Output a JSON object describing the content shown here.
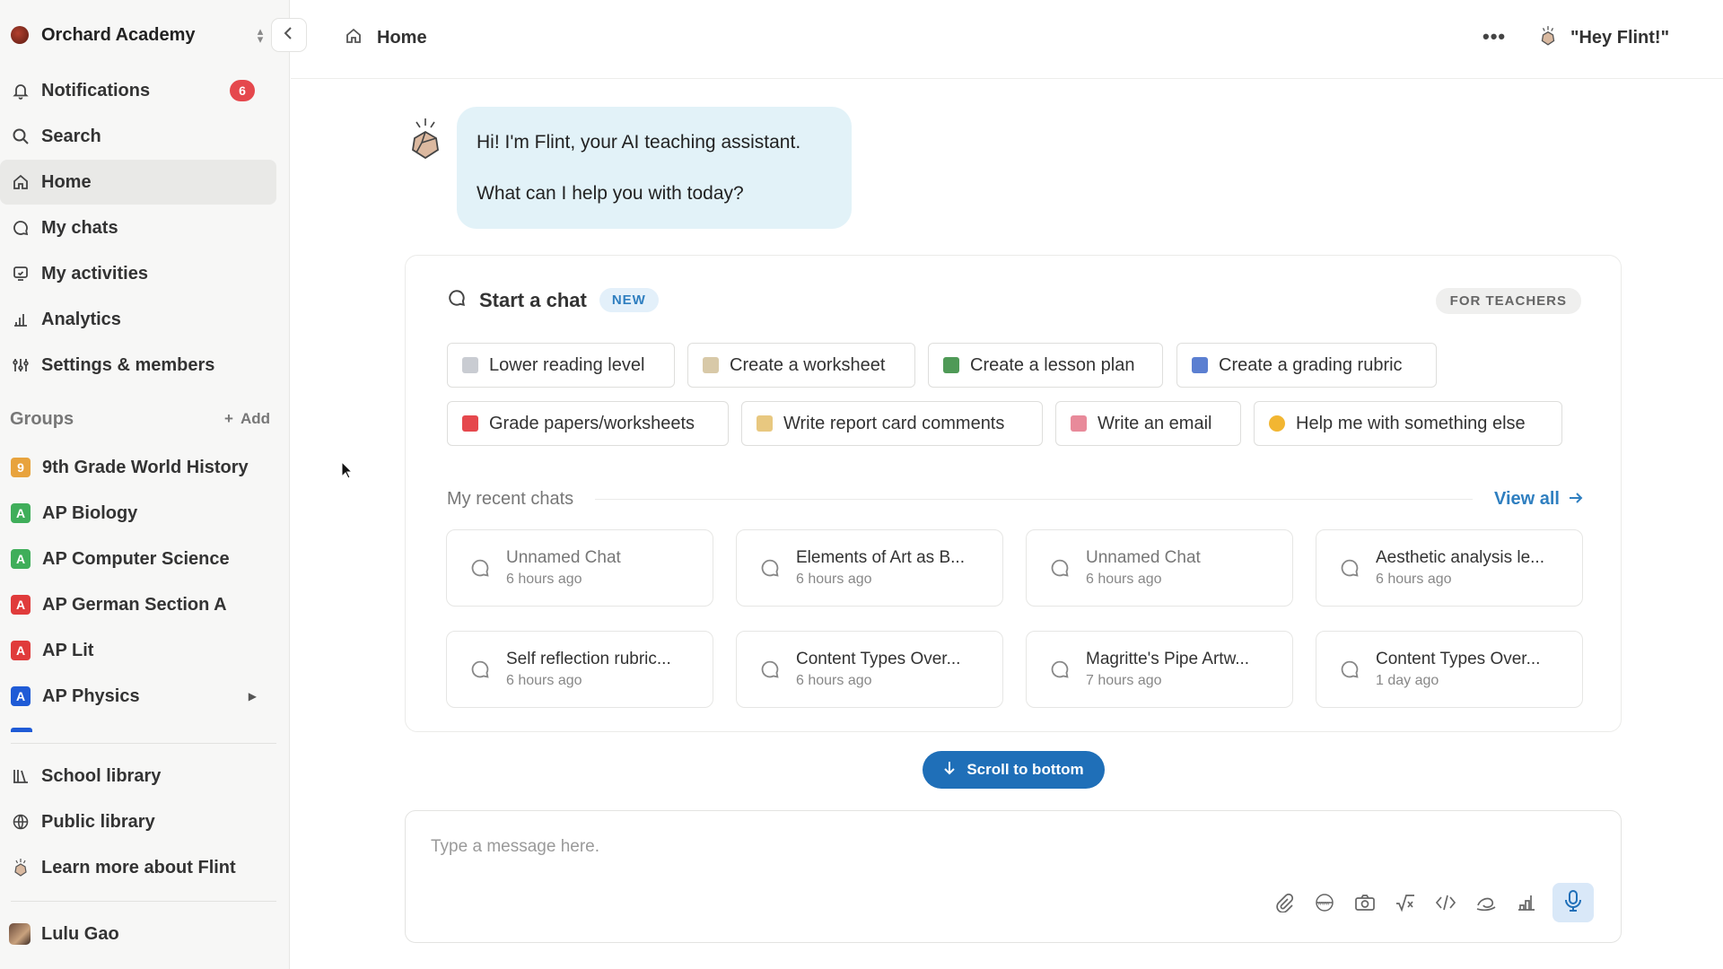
{
  "sidebar": {
    "org_name": "Orchard Academy",
    "nav": [
      {
        "label": "Notifications",
        "icon": "bell-icon",
        "badge": "6"
      },
      {
        "label": "Search",
        "icon": "search-icon"
      },
      {
        "label": "Home",
        "icon": "home-icon",
        "active": true
      },
      {
        "label": "My chats",
        "icon": "chat-bubble-icon"
      },
      {
        "label": "My activities",
        "icon": "activities-icon"
      },
      {
        "label": "Analytics",
        "icon": "analytics-icon"
      },
      {
        "label": "Settings & members",
        "icon": "settings-sliders-icon"
      }
    ],
    "groups_title": "Groups",
    "groups_add": "Add",
    "groups": [
      {
        "label": "9th Grade World History",
        "badge": "9",
        "color": "#e8a33d"
      },
      {
        "label": "AP Biology",
        "badge": "A",
        "color": "#3fae5a"
      },
      {
        "label": "AP Computer Science",
        "badge": "A",
        "color": "#3fae5a"
      },
      {
        "label": "AP German Section A",
        "badge": "A",
        "color": "#e03b3b"
      },
      {
        "label": "AP Lit",
        "badge": "A",
        "color": "#e03b3b"
      },
      {
        "label": "AP Physics",
        "badge": "A",
        "color": "#1f5bd6"
      }
    ],
    "footer_nav": [
      {
        "label": "School library",
        "icon": "library-icon"
      },
      {
        "label": "Public library",
        "icon": "globe-icon"
      },
      {
        "label": "Learn more about Flint",
        "icon": "flint-logo-icon"
      }
    ],
    "user_name": "Lulu Gao"
  },
  "topbar": {
    "breadcrumb": "Home",
    "more": "•••",
    "hey_flint": "\"Hey Flint!\""
  },
  "greeting": {
    "line1": "Hi! I'm Flint, your AI teaching assistant.",
    "line2": "What can I help you with today?"
  },
  "start_chat": {
    "title": "Start a chat",
    "new_badge": "NEW",
    "audience_badge": "FOR TEACHERS",
    "suggestions": [
      {
        "label": "Lower reading level",
        "icon": "document-icon",
        "color": "#c9ccd2"
      },
      {
        "label": "Create a worksheet",
        "icon": "notepad-icon",
        "color": "#d8c9a8"
      },
      {
        "label": "Create a lesson plan",
        "icon": "books-icon",
        "color": "#4f9a57"
      },
      {
        "label": "Create a grading rubric",
        "icon": "grid-icon",
        "color": "#5b7fd1"
      },
      {
        "label": "Grade papers/worksheets",
        "icon": "hundred-points-icon",
        "color": "#e5484d"
      },
      {
        "label": "Write report card comments",
        "icon": "memo-icon",
        "color": "#e8c880"
      },
      {
        "label": "Write an email",
        "icon": "love-letter-icon",
        "color": "#e88a9a"
      },
      {
        "label": "Help me with something else",
        "icon": "thinking-face-icon",
        "color": "#f2b632"
      }
    ],
    "recent_title": "My recent chats",
    "view_all": "View all",
    "recent_chats": [
      {
        "title": "Unnamed Chat",
        "time": "6 hours ago",
        "muted": true
      },
      {
        "title": "Elements of Art as B...",
        "time": "6 hours ago"
      },
      {
        "title": "Unnamed Chat",
        "time": "6 hours ago",
        "muted": true
      },
      {
        "title": "Aesthetic analysis le...",
        "time": "6 hours ago"
      },
      {
        "title": "Self reflection rubric...",
        "time": "6 hours ago"
      },
      {
        "title": "Content Types Over...",
        "time": "6 hours ago"
      },
      {
        "title": "Magritte's Pipe Artw...",
        "time": "7 hours ago"
      },
      {
        "title": "Content Types Over...",
        "time": "1 day ago"
      }
    ]
  },
  "scroll_button": "Scroll to bottom",
  "composer": {
    "placeholder": "Type a message here.",
    "tools": [
      "paperclip-icon",
      "www-globe-icon",
      "camera-icon",
      "square-root-icon",
      "code-icon",
      "drawing-icon",
      "chart-icon"
    ],
    "mic_icon": "microphone-icon"
  },
  "colors": {
    "accent": "#1f6fb8",
    "bubble": "#e2f2f8",
    "badge_red": "#e5484d"
  }
}
